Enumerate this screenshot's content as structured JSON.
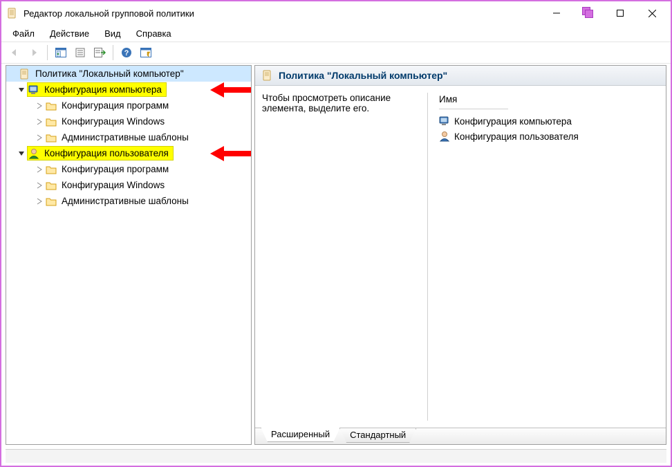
{
  "window": {
    "title": "Редактор локальной групповой политики"
  },
  "menu": {
    "file": "Файл",
    "action": "Действие",
    "view": "Вид",
    "help": "Справка"
  },
  "tree": {
    "root": "Политика \"Локальный компьютер\"",
    "computer_cfg": "Конфигурация компьютера",
    "user_cfg": "Конфигурация пользователя",
    "soft_cfg": "Конфигурация программ",
    "win_cfg": "Конфигурация Windows",
    "admin_tmpl": "Административные шаблоны"
  },
  "content": {
    "header": "Политика \"Локальный компьютер\"",
    "description": "Чтобы просмотреть описание элемента, выделите его.",
    "column_name": "Имя",
    "items": {
      "computer_cfg": "Конфигурация компьютера",
      "user_cfg": "Конфигурация пользователя"
    }
  },
  "tabs": {
    "extended": "Расширенный",
    "standard": "Стандартный"
  },
  "icons": {
    "scroll": "scroll-icon",
    "folder": "folder-icon",
    "computer": "computer-icon",
    "user": "user-icon"
  }
}
